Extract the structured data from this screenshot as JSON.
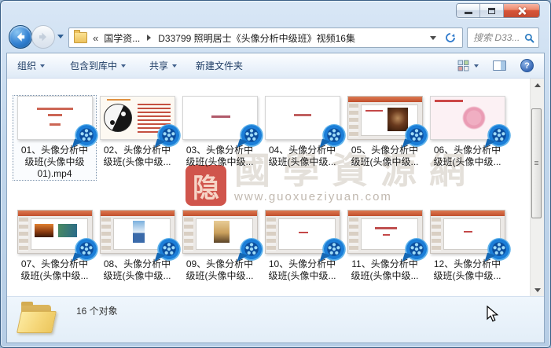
{
  "window": {
    "controls": {
      "minimize": "minimize",
      "maximize": "maximize",
      "close": "close"
    }
  },
  "navigation": {
    "breadcrumb": {
      "overflow_chevron": "«",
      "crumb_parent": "国学资...",
      "crumb_current": "D33799 照明居士《头像分析中级班》视频16集"
    },
    "search_placeholder": "搜索 D33..."
  },
  "toolbar": {
    "organize": "组织",
    "include_in_library": "包含到库中",
    "share": "共享",
    "new_folder": "新建文件夹",
    "help_glyph": "?"
  },
  "files": [
    {
      "label": "01、头像分析中\n级班(头像中级\n01).mp4",
      "selected": true
    },
    {
      "label": "02、头像分析中\n级班(头像中级..."
    },
    {
      "label": "03、头像分析中\n级班(头像中级..."
    },
    {
      "label": "04、头像分析中\n级班(头像中级..."
    },
    {
      "label": "05、头像分析中\n级班(头像中级..."
    },
    {
      "label": "06、头像分析中\n级班(头像中级..."
    },
    {
      "label": "07、头像分析中\n级班(头像中级..."
    },
    {
      "label": "08、头像分析中\n级班(头像中级..."
    },
    {
      "label": "09、头像分析中\n级班(头像中级..."
    },
    {
      "label": "10、头像分析中\n级班(头像中级..."
    },
    {
      "label": "11、头像分析中\n级班(头像中级..."
    },
    {
      "label": "12、头像分析中\n级班(头像中级..."
    }
  ],
  "watermark": {
    "seal_char": "隐",
    "site_name": "國學資源網",
    "site_url": "www.guoxueziyuan.com"
  },
  "status": {
    "item_count": "16 个对象"
  },
  "colors": {
    "badge_blue": "#1b7ed8",
    "close_red": "#d75438",
    "toolbar_text": "#1e3c64"
  }
}
